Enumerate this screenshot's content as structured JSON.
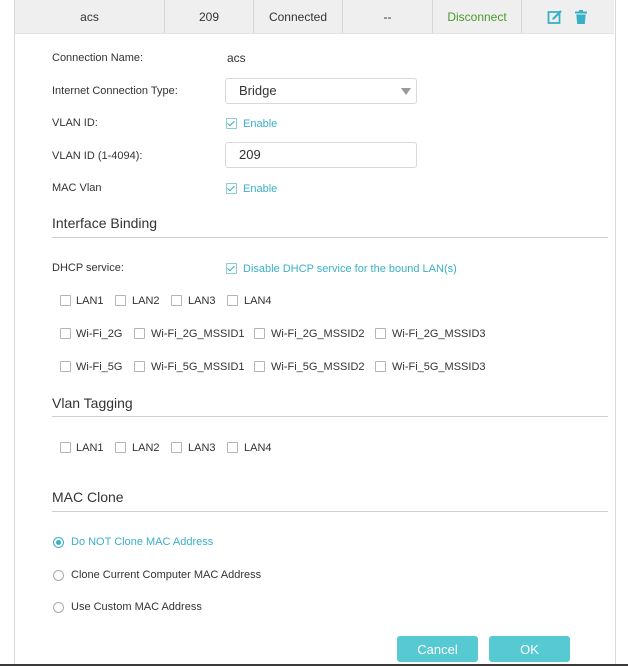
{
  "connection_row": {
    "name": "acs",
    "vlan": "209",
    "status": "Connected",
    "ip": "--",
    "action": "Disconnect",
    "edit_icon": "edit-icon",
    "delete_icon": "trash-icon"
  },
  "form": {
    "connection_name_label": "Connection Name:",
    "connection_name_value": "acs",
    "connection_type_label": "Internet Connection Type:",
    "connection_type_value": "Bridge",
    "vlan_id_label": "VLAN ID:",
    "vlan_id_enable": "Enable",
    "vlan_id_range_label": "VLAN ID (1-4094):",
    "vlan_id_value": "209",
    "mac_vlan_label": "MAC Vlan",
    "mac_vlan_enable": "Enable"
  },
  "interface_binding": {
    "title": "Interface Binding",
    "dhcp_label": "DHCP service:",
    "dhcp_option": "Disable DHCP service for the bound LAN(s)",
    "lan": [
      "LAN1",
      "LAN2",
      "LAN3",
      "LAN4"
    ],
    "wifi_2g": [
      "Wi-Fi_2G",
      "Wi-Fi_2G_MSSID1",
      "Wi-Fi_2G_MSSID2",
      "Wi-Fi_2G_MSSID3"
    ],
    "wifi_5g": [
      "Wi-Fi_5G",
      "Wi-Fi_5G_MSSID1",
      "Wi-Fi_5G_MSSID2",
      "Wi-Fi_5G_MSSID3"
    ]
  },
  "vlan_tagging": {
    "title": "Vlan Tagging",
    "lan": [
      "LAN1",
      "LAN2",
      "LAN3",
      "LAN4"
    ]
  },
  "mac_clone": {
    "title": "MAC Clone",
    "options": [
      "Do NOT Clone MAC Address",
      "Clone Current Computer MAC Address",
      "Use Custom MAC Address"
    ],
    "selected": "Do NOT Clone MAC Address"
  },
  "buttons": {
    "cancel": "Cancel",
    "ok": "OK"
  },
  "colors": {
    "accent": "#3ab0c6",
    "button": "#56c9d2",
    "disconnect": "#4a9a2b"
  }
}
